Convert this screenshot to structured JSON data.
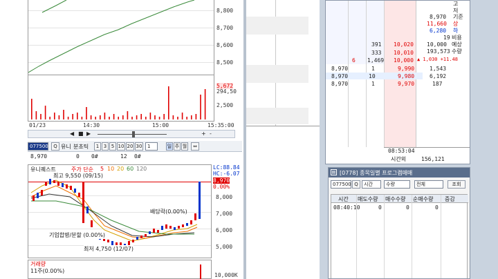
{
  "colors": {
    "accent_red": "#e00000",
    "accent_blue": "#0033cc",
    "up_bg": "#ffe6e6",
    "down_bg": "#e6ecff"
  },
  "top_chart": {
    "y_ticks": [
      "8,800",
      "8,700",
      "8,600",
      "8,500"
    ],
    "vol_ticks": [
      "5,672",
      "294,50",
      "2,500"
    ],
    "x_labels": [
      "01/23",
      "14:30",
      "15:00",
      "15:35:00"
    ]
  },
  "toolbar1": {
    "code": "077500",
    "name": "유니",
    "period_label": "분초틱",
    "periods": [
      "1",
      "3",
      "5",
      "10",
      "20",
      "30"
    ],
    "more": "1",
    "day_btn": "일",
    "week_btn": "주",
    "month_btn": "월"
  },
  "info_row": {
    "price": "8,970",
    "f1": "0",
    "f2": "0#",
    "f3": "12",
    "f4": "0#"
  },
  "daily_chart": {
    "legend_name": "유니퀘스트",
    "legend_ma": "주가 단순",
    "legend_ma_vals": [
      "5",
      "10",
      "20",
      "60",
      "120"
    ],
    "lc_label": "LC:88.84",
    "hc_label": "HC:-6.07",
    "max_label": "최고 9,550 (09/15)",
    "min_label": "최저 4,750 (12/07)",
    "dividend_label": "배당락(0.00%)",
    "split_label": "기업합병/분할 (0.00%)",
    "price_tag": "8,970",
    "pct_tag": "0.00%",
    "y_ticks": [
      "8,000",
      "7,000",
      "6,000",
      "5,000"
    ],
    "volume_title": "거래량",
    "volume_sub": "11주(0.00%)",
    "volume_tick": "10,000K"
  },
  "orderbook": {
    "right_labels": [
      "고",
      "저",
      "기준",
      "상",
      "하",
      "비용",
      "예상",
      "수량"
    ],
    "right_values": [
      "8,970",
      "11,660",
      "6,280",
      "19",
      "10,000",
      "193,573",
      "▲ 1,030  +11.48"
    ],
    "ask_rows": [
      {
        "qty": "391",
        "price": "10,020"
      },
      {
        "qty": "333",
        "price": "10,010"
      },
      {
        "cnt": "6",
        "qty": "1,469",
        "price": "10,000"
      }
    ],
    "bid_rows": [
      {
        "trade": "8,970",
        "n": "1",
        "price": "9,990",
        "qty": "1,543"
      },
      {
        "trade": "8,970",
        "n": "10",
        "price": "9,980",
        "qty": "6,192"
      },
      {
        "trade": "8,970",
        "n": "1",
        "price": "9,970",
        "qty": "187"
      }
    ],
    "footer_time": "08:53:04",
    "footer_label": "시간외",
    "footer_value": "156,121"
  },
  "program_window": {
    "title": "[0778] 종목일별 프로그램매매",
    "code": "077500",
    "sel1": "시간",
    "sel2": "수량",
    "sel3": "전체",
    "query_btn": "조회",
    "headers": [
      "시간",
      "매도수량",
      "매수수량",
      "순매수량",
      "증감"
    ],
    "row": [
      "08:40:10",
      "0",
      "0",
      "0",
      ""
    ]
  }
}
